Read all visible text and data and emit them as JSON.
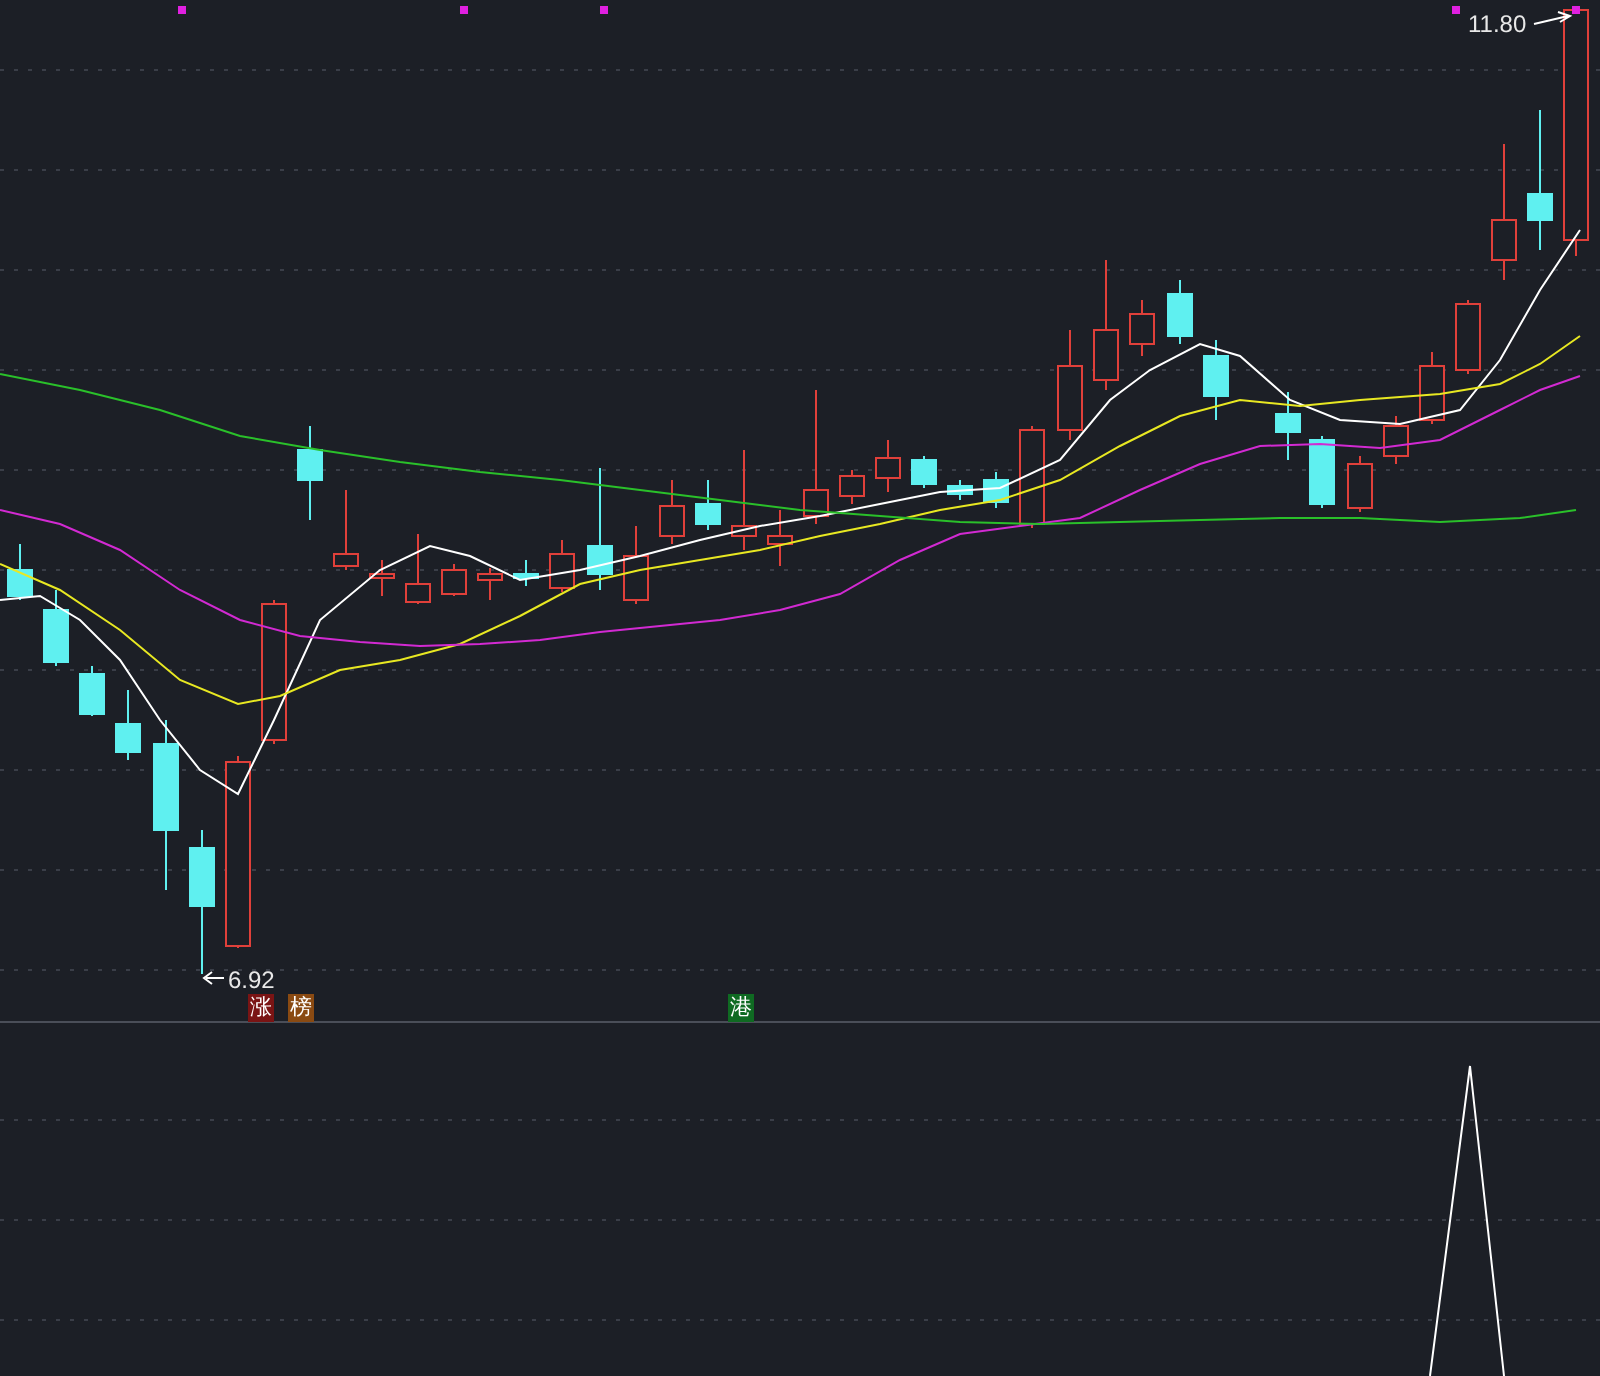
{
  "price_chart": {
    "high_label": "11.80",
    "low_label": "6.92",
    "badges": [
      {
        "text": "涨",
        "color": "#7a1414"
      },
      {
        "text": "榜",
        "color": "#8a4a12"
      },
      {
        "text": "港",
        "color": "#0f6a22"
      }
    ]
  }
}
